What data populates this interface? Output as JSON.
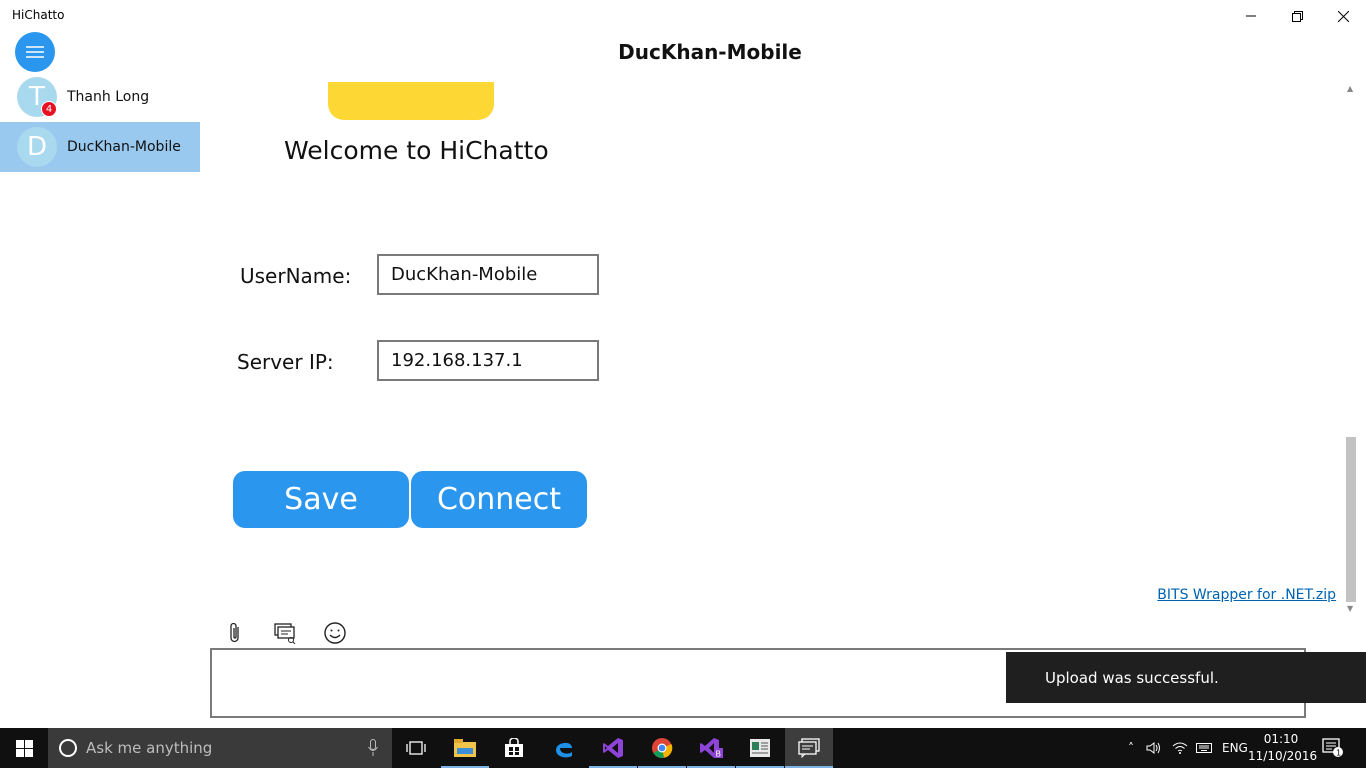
{
  "window": {
    "title": "HiChatto"
  },
  "sidebar": {
    "contacts": [
      {
        "initial": "T",
        "name": "Thanh Long",
        "unread": "4",
        "selected": false
      },
      {
        "initial": "D",
        "name": "DucKhan-Mobile",
        "selected": true
      }
    ]
  },
  "chat": {
    "title": "DucKhan-Mobile",
    "welcome": "Welcome to HiChatto",
    "form": {
      "username_label": "UserName:",
      "username_value": "DucKhan-Mobile",
      "server_ip_label": "Server IP:",
      "server_ip_value": "192.168.137.1",
      "save_label": "Save",
      "connect_label": "Connect"
    },
    "attachment_link": "BITS Wrapper for .NET.zip",
    "message_input": ""
  },
  "toast": {
    "message": "Upload was successful."
  },
  "taskbar": {
    "search_placeholder": "Ask me anything",
    "language": "ENG",
    "time": "01:10",
    "date": "11/10/2016",
    "notifications_count": "1",
    "apps": [
      "file-explorer-icon",
      "store-icon",
      "edge-icon",
      "visual-studio-icon",
      "chrome-icon",
      "visual-studio-blend-icon",
      "publisher-icon",
      "hichatto-icon"
    ]
  },
  "colors": {
    "accent": "#2a96ee",
    "selected_contact": "#99c9ef",
    "avatar": "#a9d9ee",
    "badge": "#e81123",
    "toast_bg": "#1f1f1f",
    "taskbar_bg": "#101010",
    "link": "#0063b1"
  }
}
